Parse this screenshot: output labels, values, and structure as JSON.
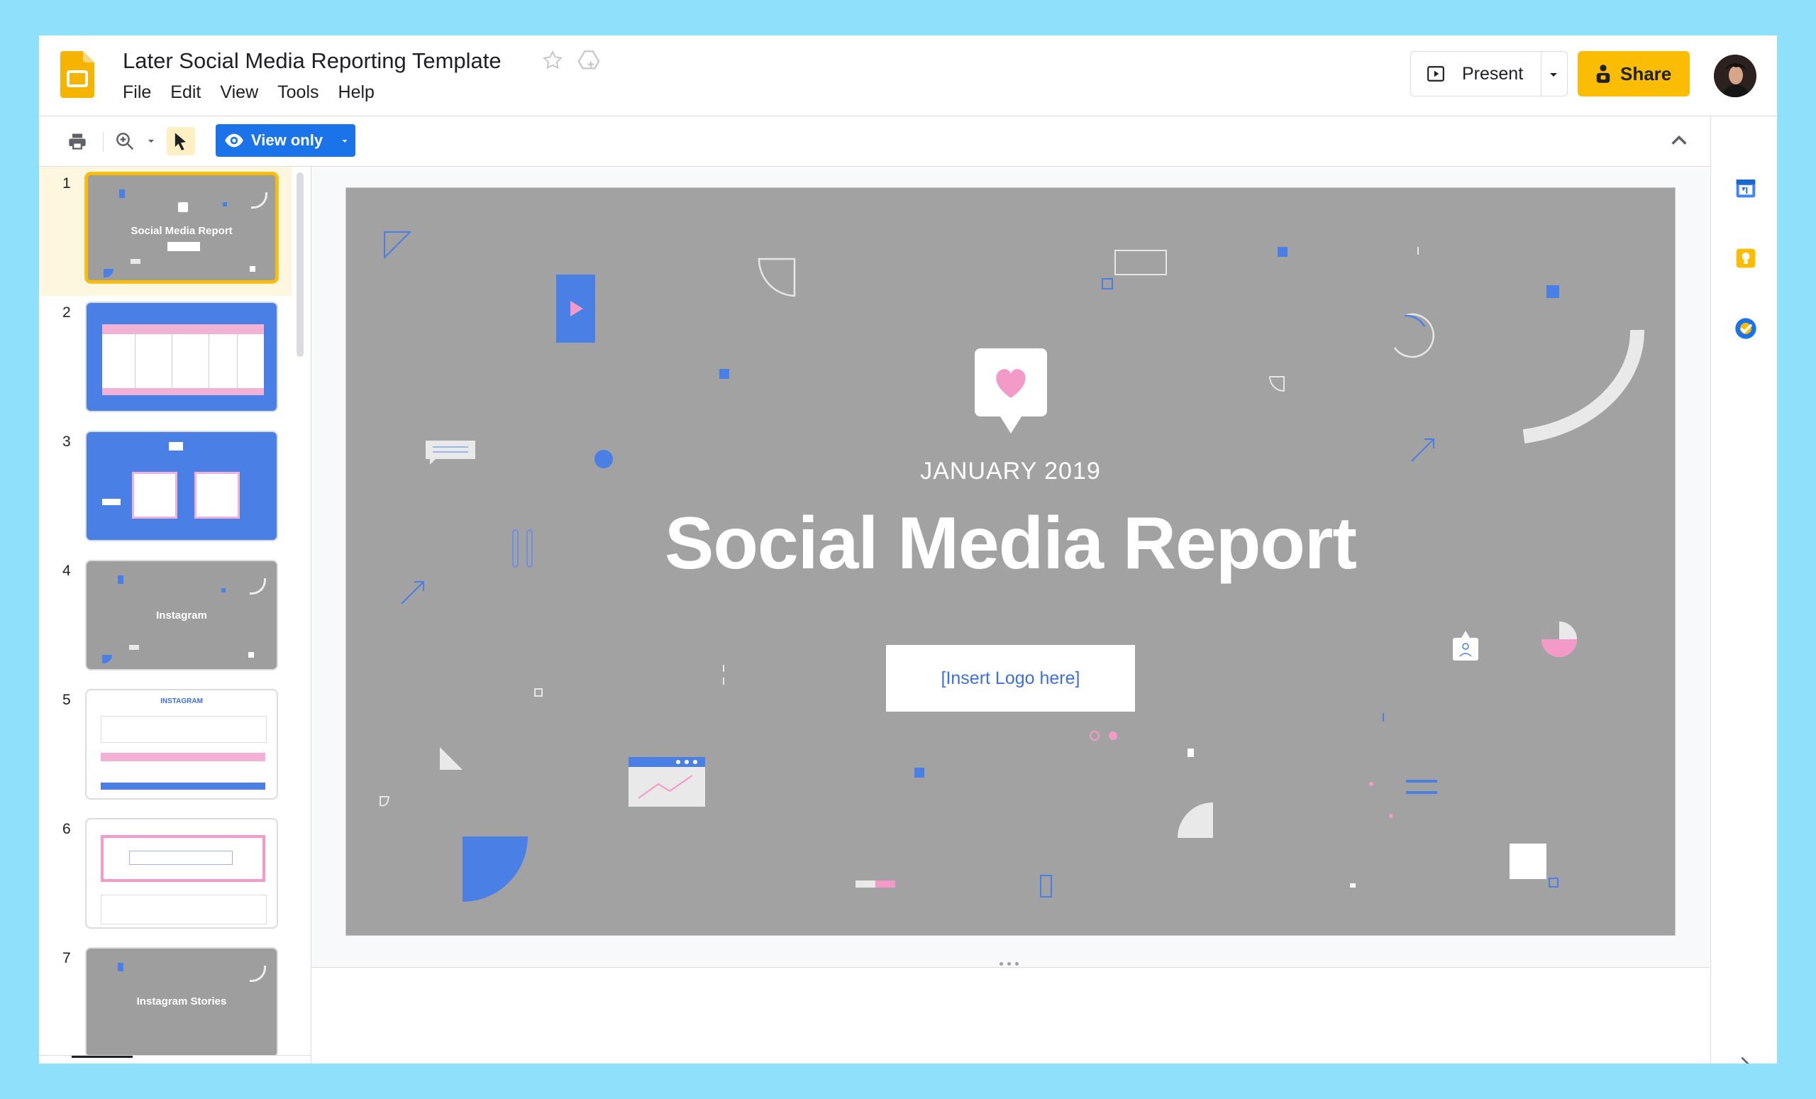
{
  "document": {
    "title": "Later Social Media Reporting Template"
  },
  "menu": [
    "File",
    "Edit",
    "View",
    "Tools",
    "Help"
  ],
  "header": {
    "present_label": "Present",
    "share_label": "Share"
  },
  "toolbar": {
    "mode_label": "View only"
  },
  "thumbnails": [
    {
      "number": "1",
      "title": "Social Media Report",
      "style": "grey",
      "selected": true
    },
    {
      "number": "2",
      "title": "",
      "style": "blue-table",
      "selected": false
    },
    {
      "number": "3",
      "title": "",
      "style": "blue-frames",
      "selected": false
    },
    {
      "number": "4",
      "title": "Instagram",
      "style": "grey",
      "selected": false
    },
    {
      "number": "5",
      "title": "INSTAGRAM",
      "style": "white-table",
      "selected": false
    },
    {
      "number": "6",
      "title": "",
      "style": "white-pink",
      "selected": false
    },
    {
      "number": "7",
      "title": "Instagram Stories",
      "style": "grey",
      "selected": false
    }
  ],
  "slide": {
    "subtitle": "JANUARY 2019",
    "title": "Social Media Report",
    "logo_placeholder": "[Insert Logo here]"
  },
  "colors": {
    "accent_yellow": "#fbbc04",
    "accent_blue": "#1a73e8",
    "slide_grey": "#a2a2a2",
    "slide_shape_blue": "#4a7fe6",
    "slide_shape_pink": "#f49ac8",
    "page_background": "#8fe1fb"
  },
  "icons": {
    "app": "google-slides-icon",
    "star": "star-icon",
    "drive": "move-to-drive-icon",
    "print": "print-icon",
    "zoom": "zoom-icon",
    "select": "pointer-icon",
    "view": "eye-icon",
    "calendar": "calendar-icon",
    "keep": "keep-icon",
    "tasks": "tasks-icon"
  }
}
